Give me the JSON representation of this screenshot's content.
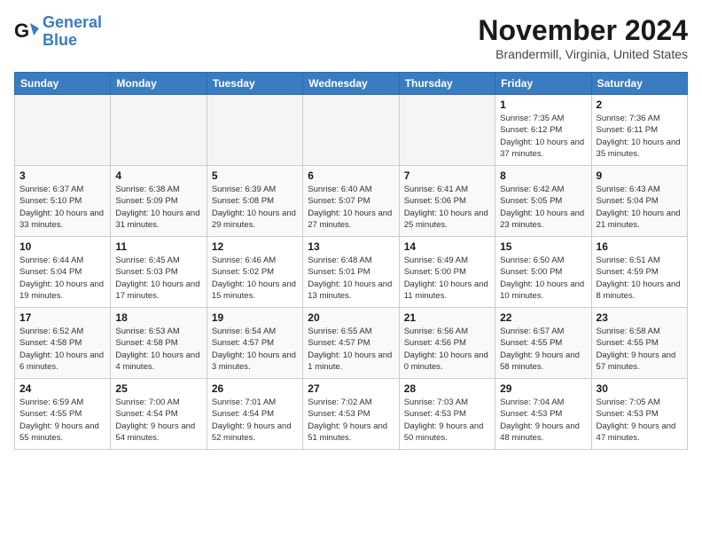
{
  "header": {
    "logo_line1": "General",
    "logo_line2": "Blue",
    "month": "November 2024",
    "location": "Brandermill, Virginia, United States"
  },
  "weekdays": [
    "Sunday",
    "Monday",
    "Tuesday",
    "Wednesday",
    "Thursday",
    "Friday",
    "Saturday"
  ],
  "weeks": [
    [
      {
        "day": "",
        "info": ""
      },
      {
        "day": "",
        "info": ""
      },
      {
        "day": "",
        "info": ""
      },
      {
        "day": "",
        "info": ""
      },
      {
        "day": "",
        "info": ""
      },
      {
        "day": "1",
        "info": "Sunrise: 7:35 AM\nSunset: 6:12 PM\nDaylight: 10 hours and 37 minutes."
      },
      {
        "day": "2",
        "info": "Sunrise: 7:36 AM\nSunset: 6:11 PM\nDaylight: 10 hours and 35 minutes."
      }
    ],
    [
      {
        "day": "3",
        "info": "Sunrise: 6:37 AM\nSunset: 5:10 PM\nDaylight: 10 hours and 33 minutes."
      },
      {
        "day": "4",
        "info": "Sunrise: 6:38 AM\nSunset: 5:09 PM\nDaylight: 10 hours and 31 minutes."
      },
      {
        "day": "5",
        "info": "Sunrise: 6:39 AM\nSunset: 5:08 PM\nDaylight: 10 hours and 29 minutes."
      },
      {
        "day": "6",
        "info": "Sunrise: 6:40 AM\nSunset: 5:07 PM\nDaylight: 10 hours and 27 minutes."
      },
      {
        "day": "7",
        "info": "Sunrise: 6:41 AM\nSunset: 5:06 PM\nDaylight: 10 hours and 25 minutes."
      },
      {
        "day": "8",
        "info": "Sunrise: 6:42 AM\nSunset: 5:05 PM\nDaylight: 10 hours and 23 minutes."
      },
      {
        "day": "9",
        "info": "Sunrise: 6:43 AM\nSunset: 5:04 PM\nDaylight: 10 hours and 21 minutes."
      }
    ],
    [
      {
        "day": "10",
        "info": "Sunrise: 6:44 AM\nSunset: 5:04 PM\nDaylight: 10 hours and 19 minutes."
      },
      {
        "day": "11",
        "info": "Sunrise: 6:45 AM\nSunset: 5:03 PM\nDaylight: 10 hours and 17 minutes."
      },
      {
        "day": "12",
        "info": "Sunrise: 6:46 AM\nSunset: 5:02 PM\nDaylight: 10 hours and 15 minutes."
      },
      {
        "day": "13",
        "info": "Sunrise: 6:48 AM\nSunset: 5:01 PM\nDaylight: 10 hours and 13 minutes."
      },
      {
        "day": "14",
        "info": "Sunrise: 6:49 AM\nSunset: 5:00 PM\nDaylight: 10 hours and 11 minutes."
      },
      {
        "day": "15",
        "info": "Sunrise: 6:50 AM\nSunset: 5:00 PM\nDaylight: 10 hours and 10 minutes."
      },
      {
        "day": "16",
        "info": "Sunrise: 6:51 AM\nSunset: 4:59 PM\nDaylight: 10 hours and 8 minutes."
      }
    ],
    [
      {
        "day": "17",
        "info": "Sunrise: 6:52 AM\nSunset: 4:58 PM\nDaylight: 10 hours and 6 minutes."
      },
      {
        "day": "18",
        "info": "Sunrise: 6:53 AM\nSunset: 4:58 PM\nDaylight: 10 hours and 4 minutes."
      },
      {
        "day": "19",
        "info": "Sunrise: 6:54 AM\nSunset: 4:57 PM\nDaylight: 10 hours and 3 minutes."
      },
      {
        "day": "20",
        "info": "Sunrise: 6:55 AM\nSunset: 4:57 PM\nDaylight: 10 hours and 1 minute."
      },
      {
        "day": "21",
        "info": "Sunrise: 6:56 AM\nSunset: 4:56 PM\nDaylight: 10 hours and 0 minutes."
      },
      {
        "day": "22",
        "info": "Sunrise: 6:57 AM\nSunset: 4:55 PM\nDaylight: 9 hours and 58 minutes."
      },
      {
        "day": "23",
        "info": "Sunrise: 6:58 AM\nSunset: 4:55 PM\nDaylight: 9 hours and 57 minutes."
      }
    ],
    [
      {
        "day": "24",
        "info": "Sunrise: 6:59 AM\nSunset: 4:55 PM\nDaylight: 9 hours and 55 minutes."
      },
      {
        "day": "25",
        "info": "Sunrise: 7:00 AM\nSunset: 4:54 PM\nDaylight: 9 hours and 54 minutes."
      },
      {
        "day": "26",
        "info": "Sunrise: 7:01 AM\nSunset: 4:54 PM\nDaylight: 9 hours and 52 minutes."
      },
      {
        "day": "27",
        "info": "Sunrise: 7:02 AM\nSunset: 4:53 PM\nDaylight: 9 hours and 51 minutes."
      },
      {
        "day": "28",
        "info": "Sunrise: 7:03 AM\nSunset: 4:53 PM\nDaylight: 9 hours and 50 minutes."
      },
      {
        "day": "29",
        "info": "Sunrise: 7:04 AM\nSunset: 4:53 PM\nDaylight: 9 hours and 48 minutes."
      },
      {
        "day": "30",
        "info": "Sunrise: 7:05 AM\nSunset: 4:53 PM\nDaylight: 9 hours and 47 minutes."
      }
    ]
  ]
}
